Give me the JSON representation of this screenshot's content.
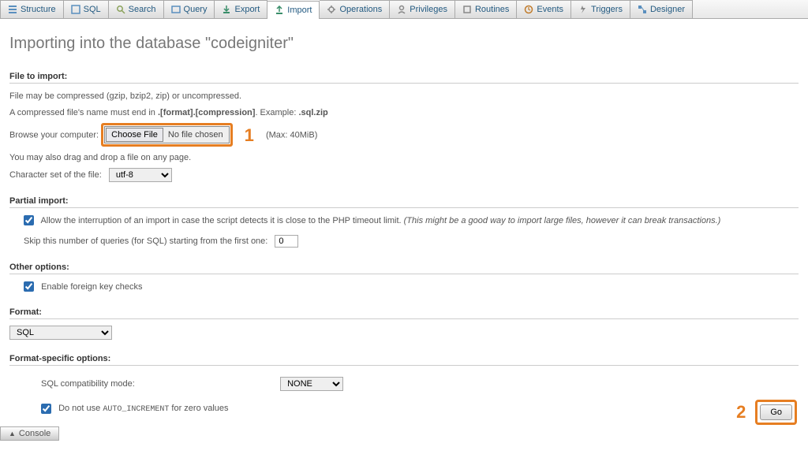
{
  "tabs": [
    {
      "label": "Structure",
      "icon": "structure-icon",
      "color": "#5a8fbe"
    },
    {
      "label": "SQL",
      "icon": "sql-icon",
      "color": "#5a8fbe"
    },
    {
      "label": "Search",
      "icon": "search-icon",
      "color": "#8aa15a"
    },
    {
      "label": "Query",
      "icon": "query-icon",
      "color": "#5a8fbe"
    },
    {
      "label": "Export",
      "icon": "export-icon",
      "color": "#3a8e6a"
    },
    {
      "label": "Import",
      "icon": "import-icon",
      "color": "#3a8e6a",
      "active": true
    },
    {
      "label": "Operations",
      "icon": "operations-icon",
      "color": "#888"
    },
    {
      "label": "Privileges",
      "icon": "privileges-icon",
      "color": "#888"
    },
    {
      "label": "Routines",
      "icon": "routines-icon",
      "color": "#888"
    },
    {
      "label": "Events",
      "icon": "events-icon",
      "color": "#c07b2b"
    },
    {
      "label": "Triggers",
      "icon": "triggers-icon",
      "color": "#888"
    },
    {
      "label": "Designer",
      "icon": "designer-icon",
      "color": "#5a8fbe"
    }
  ],
  "page_heading": "Importing into the database \"codeigniter\"",
  "file_to_import": {
    "title": "File to import:",
    "help1": "File may be compressed (gzip, bzip2, zip) or uncompressed.",
    "help2a": "A compressed file's name must end in ",
    "help2b": ".[format].[compression]",
    "help2c": ". Example: ",
    "help2d": ".sql.zip",
    "browse_label": "Browse your computer:",
    "choose_btn": "Choose File",
    "no_file": "No file chosen",
    "max": "(Max: 40MiB)",
    "drag_hint": "You may also drag and drop a file on any page.",
    "charset_label": "Character set of the file:",
    "charset_value": "utf-8"
  },
  "partial_import": {
    "title": "Partial import:",
    "allow_interrupt_a": "Allow the interruption of an import in case the script detects it is close to the PHP timeout limit. ",
    "allow_interrupt_b": "(This might be a good way to import large files, however it can break transactions.)",
    "allow_checked": true,
    "skip_label": "Skip this number of queries (for SQL) starting from the first one:",
    "skip_value": "0"
  },
  "other_options": {
    "title": "Other options:",
    "fk_label": "Enable foreign key checks",
    "fk_checked": true
  },
  "format": {
    "title": "Format:",
    "value": "SQL"
  },
  "format_specific": {
    "title": "Format-specific options:",
    "compat_label": "SQL compatibility mode:",
    "compat_value": "NONE",
    "autoinc_label_a": "Do not use ",
    "autoinc_code": "AUTO_INCREMENT",
    "autoinc_label_b": " for zero values",
    "autoinc_checked": true
  },
  "go_btn": "Go",
  "console": "Console",
  "annotations": {
    "one": "1",
    "two": "2"
  }
}
